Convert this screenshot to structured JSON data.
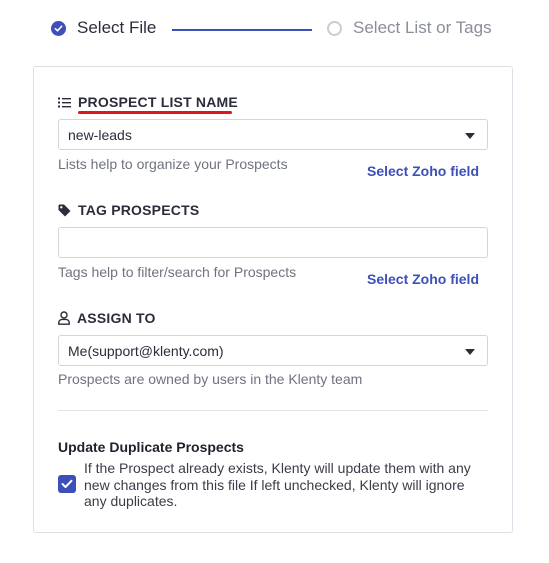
{
  "stepper": {
    "steps": [
      {
        "label": "Select File",
        "state": "active"
      },
      {
        "label": "Select List or Tags",
        "state": "inactive"
      }
    ]
  },
  "prospect_list": {
    "title": "PROSPECT LIST NAME",
    "selected": "new-leads",
    "help": "Lists help to organize your Prospects",
    "zoho_link": "Select Zoho field"
  },
  "tags": {
    "title": "TAG PROSPECTS",
    "value": "",
    "help": "Tags help to filter/search for Prospects",
    "zoho_link": "Select Zoho field"
  },
  "assign": {
    "title": "ASSIGN TO",
    "selected": "Me(support@klenty.com)",
    "help": "Prospects are owned by users in the Klenty team"
  },
  "duplicates": {
    "title": "Update Duplicate Prospects",
    "checked": true,
    "description": "If the Prospect already exists, Klenty will update them with any new changes from this file If left unchecked, Klenty will ignore any duplicates."
  },
  "colors": {
    "accent": "#3d4fb8",
    "highlight_underline": "#e0161d"
  }
}
